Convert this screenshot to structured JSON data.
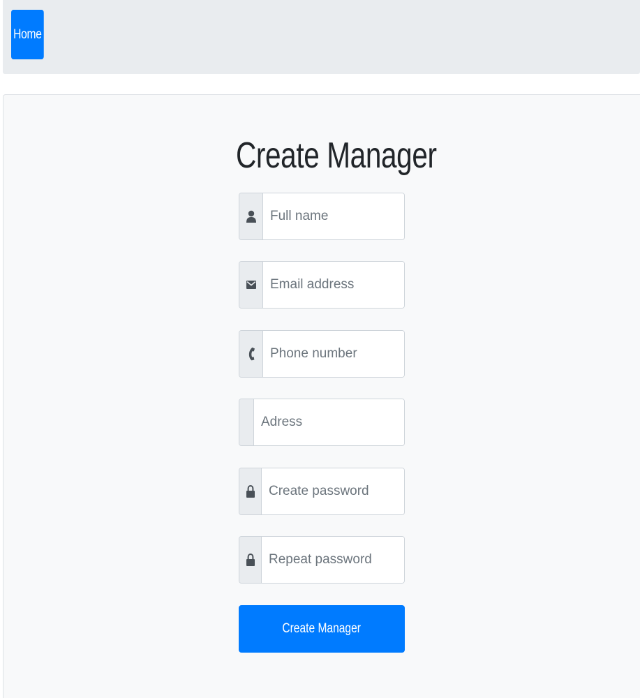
{
  "navbar": {
    "home_label": "Home",
    "accent_color": "#007bff",
    "background_color": "#e9ecef"
  },
  "form": {
    "title": "Create Manager",
    "fields": [
      {
        "icon": "user-icon",
        "placeholder": "Full name",
        "value": ""
      },
      {
        "icon": "envelope-icon",
        "placeholder": "Email address",
        "value": ""
      },
      {
        "icon": "phone-icon",
        "placeholder": "Phone number",
        "value": ""
      },
      {
        "icon": "",
        "placeholder": "Adress",
        "value": ""
      },
      {
        "icon": "lock-icon",
        "placeholder": "Create password",
        "value": ""
      },
      {
        "icon": "lock-icon",
        "placeholder": "Repeat password",
        "value": ""
      }
    ],
    "submit_label": "Create Manager"
  }
}
